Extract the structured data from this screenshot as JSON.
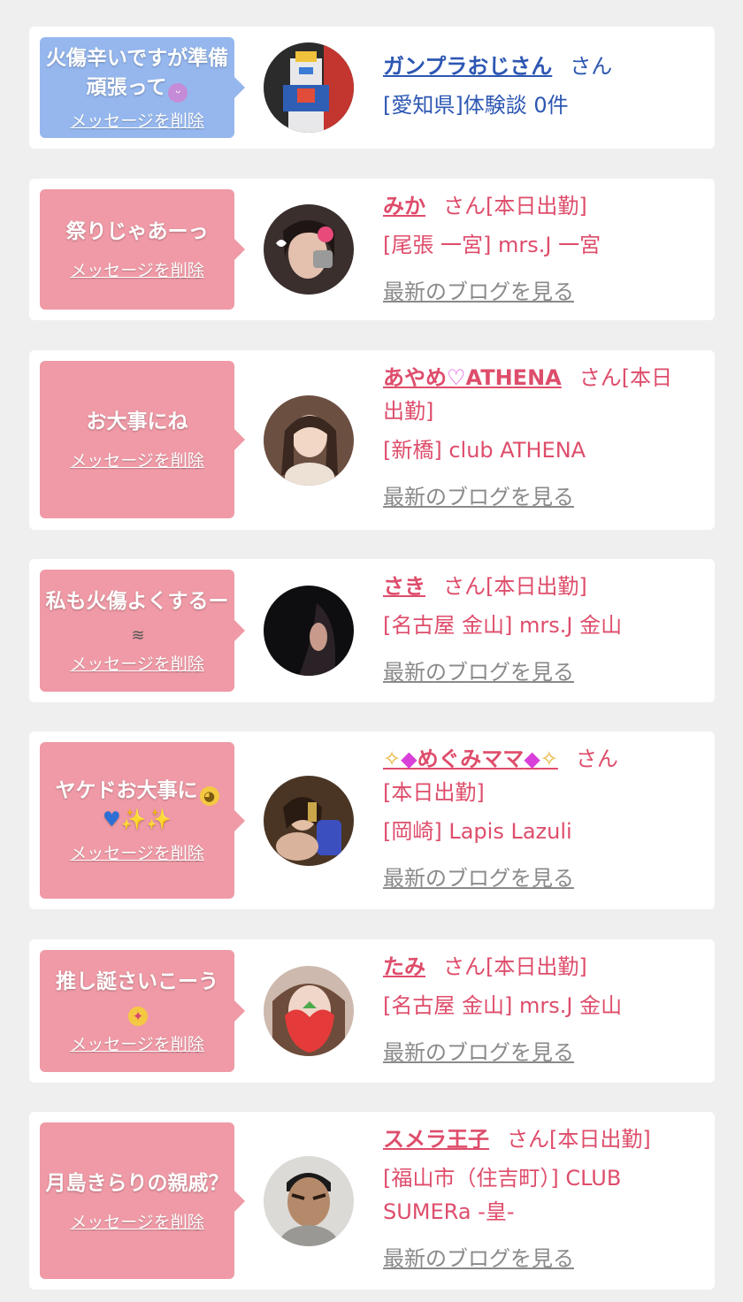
{
  "delete_label": "メッセージを削除",
  "blog_label": "最新のブログを見る",
  "colors": {
    "page_bg": "#efefef",
    "card_bg": "#ffffff",
    "pink_bubble": "#ef9aa6",
    "blue_bubble": "#95b7ee",
    "pink_text": "#de4d6b",
    "blue_text": "#2d57b3",
    "gray_link": "#8a8a8a"
  },
  "items": [
    {
      "message": "火傷辛いですが準備頑張って",
      "message_emoji": "grinning-sweat-emoji",
      "name": "ガンプラおじさん",
      "suffix": "さん",
      "location": "[愛知県]体験談 0件"
    },
    {
      "message": "祭りじゃあーっ",
      "name": "みか",
      "suffix": "さん[本日出勤]",
      "location": "[尾張 一宮] mrs.J 一宮"
    },
    {
      "message": "お大事にね",
      "name_prefix": "あやめ",
      "name_icon": "heart-icon",
      "name_rest": "ATHENA",
      "suffix_1": "さん[本日",
      "suffix_2": "出勤]",
      "location": "[新橋] club ATHENA"
    },
    {
      "message": "私も火傷よくするー",
      "message_emoji": "dash-emoji",
      "name": "さき",
      "suffix": "さん[本日出勤]",
      "location": "[名古屋 金山] mrs.J 金山"
    },
    {
      "message": "ヤケドお大事に",
      "message_emojis": [
        "pleading-face-emoji",
        "blue-heart-emoji",
        "sparkles-emoji",
        "sparkles-emoji"
      ],
      "name": "めぐみママ",
      "name_icons": [
        "sparkles-icon",
        "gem-icon",
        "gem-icon",
        "sparkles-icon"
      ],
      "suffix": "さん",
      "suffix_2": "[本日出勤]",
      "location": "[岡崎] Lapis Lazuli"
    },
    {
      "message": "推し誕さいこーう",
      "message_emoji": "party-face-emoji",
      "name": "たみ",
      "suffix": "さん[本日出勤]",
      "location": "[名古屋 金山] mrs.J 金山"
    },
    {
      "message": "月島きらりの親戚？",
      "name": "スメラ王子",
      "suffix": "さん[本日出勤]",
      "location_1": "[福山市（住吉町）] CLUB",
      "location_2": "SUMERa -皇-"
    }
  ]
}
